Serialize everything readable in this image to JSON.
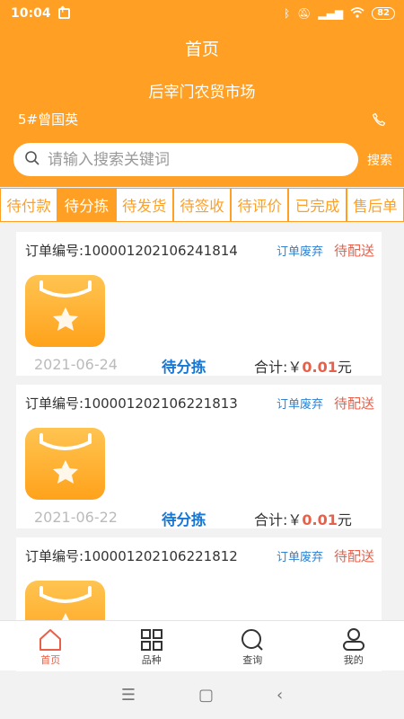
{
  "status_bar": {
    "time": "10:04",
    "battery": "82"
  },
  "header": {
    "title": "首页",
    "market": "后宰门农贸市场",
    "user": "5#曾国英"
  },
  "search": {
    "placeholder": "请输入搜索关键词",
    "button": "搜索"
  },
  "tabs": [
    {
      "label": "待付款"
    },
    {
      "label": "待分拣",
      "active": true
    },
    {
      "label": "待发货"
    },
    {
      "label": "待签收"
    },
    {
      "label": "待评价"
    },
    {
      "label": "已完成"
    },
    {
      "label": "售后单"
    }
  ],
  "orders": [
    {
      "order_no": "订单编号:100001202106241814",
      "discard": "订单废弃",
      "status": "待配送",
      "date": "2021-06-24",
      "phase": "待分拣",
      "total_label": "合计:￥",
      "amount": "0.01",
      "unit": "元"
    },
    {
      "order_no": "订单编号:100001202106221813",
      "discard": "订单废弃",
      "status": "待配送",
      "date": "2021-06-22",
      "phase": "待分拣",
      "total_label": "合计:￥",
      "amount": "0.01",
      "unit": "元"
    },
    {
      "order_no": "订单编号:100001202106221812",
      "discard": "订单废弃",
      "status": "待配送"
    }
  ],
  "bottom_nav": [
    {
      "label": "首页",
      "icon": "home-icon",
      "active": true
    },
    {
      "label": "品种",
      "icon": "grid-icon"
    },
    {
      "label": "查询",
      "icon": "search-icon"
    },
    {
      "label": "我的",
      "icon": "user-icon"
    }
  ],
  "colors": {
    "accent": "#ffa024",
    "status_red": "#e8604a",
    "link_blue": "#2d83d6"
  }
}
